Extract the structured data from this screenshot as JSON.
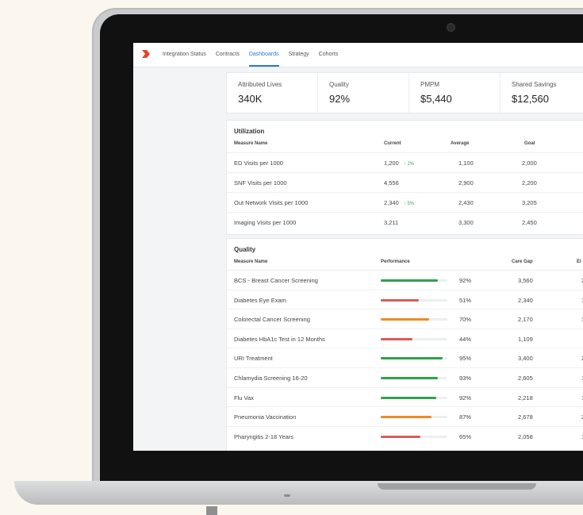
{
  "nav": {
    "tabs": [
      {
        "label": "Integration Status",
        "active": false
      },
      {
        "label": "Contracts",
        "active": false
      },
      {
        "label": "Dashboards",
        "active": true
      },
      {
        "label": "Strategy",
        "active": false
      },
      {
        "label": "Cohorts",
        "active": false
      }
    ],
    "logo_icon": "chevron-logo-icon",
    "accent_color": "#2a7bd4",
    "logo_color": "#e8432f"
  },
  "kpis": [
    {
      "label": "Attributed Lives",
      "value": "340K"
    },
    {
      "label": "Quality",
      "value": "92%"
    },
    {
      "label": "PMPM",
      "value": "$5,440"
    },
    {
      "label": "Shared Savings",
      "value": "$12,560"
    }
  ],
  "utilization": {
    "title": "Utilization",
    "columns": {
      "name": "Measure Name",
      "current": "Current",
      "average": "Average",
      "goal": "Goal"
    },
    "rows": [
      {
        "name": "ED Visits per 1000",
        "current": "1,200",
        "trend": "↑ 2%",
        "average": "1,100",
        "goal": "2,000"
      },
      {
        "name": "SNF Visits per 1000",
        "current": "4,556",
        "trend": "",
        "average": "2,900",
        "goal": "2,200"
      },
      {
        "name": "Out Network Visits per 1000",
        "current": "2,340",
        "trend": "↑ 5%",
        "average": "2,430",
        "goal": "3,205"
      },
      {
        "name": "Imaging Visits per 1000",
        "current": "3,211",
        "trend": "",
        "average": "3,300",
        "goal": "2,450"
      }
    ]
  },
  "quality": {
    "title": "Quality",
    "columns": {
      "name": "Measure Name",
      "performance": "Performance",
      "care_gap": "Care Gap",
      "eligible": "El"
    },
    "colors": {
      "good": "#2fa24c",
      "warn": "#f08a24",
      "bad": "#d95b5b"
    },
    "rows": [
      {
        "name": "BCS - Breast Cancer Screening",
        "percent": "92%",
        "fill": 0.86,
        "status": "good",
        "care_gap": "3,560",
        "eligible": "2"
      },
      {
        "name": "Diabetes Eye Exam",
        "percent": "51%",
        "fill": 0.57,
        "status": "bad",
        "care_gap": "2,340",
        "eligible": "1"
      },
      {
        "name": "Colorectal Cancer Screening",
        "percent": "70%",
        "fill": 0.73,
        "status": "warn",
        "care_gap": "2,170",
        "eligible": "1"
      },
      {
        "name": "Diabetes HbA1c Test in 12 Months",
        "percent": "44%",
        "fill": 0.48,
        "status": "bad",
        "care_gap": "1,109",
        "eligible": ""
      },
      {
        "name": "URI Treatment",
        "percent": "95%",
        "fill": 0.93,
        "status": "good",
        "care_gap": "3,400",
        "eligible": "2"
      },
      {
        "name": "Chlamydia Screening 16-20",
        "percent": "93%",
        "fill": 0.86,
        "status": "good",
        "care_gap": "2,605",
        "eligible": "1"
      },
      {
        "name": "Flu Vax",
        "percent": "92%",
        "fill": 0.83,
        "status": "good",
        "care_gap": "2,218",
        "eligible": "1"
      },
      {
        "name": "Pneumonia Vaccination",
        "percent": "87%",
        "fill": 0.76,
        "status": "warn",
        "care_gap": "2,678",
        "eligible": "2"
      },
      {
        "name": "Pharyngitis 2-18 Years",
        "percent": "65%",
        "fill": 0.59,
        "status": "bad",
        "care_gap": "2,058",
        "eligible": "1"
      }
    ]
  }
}
